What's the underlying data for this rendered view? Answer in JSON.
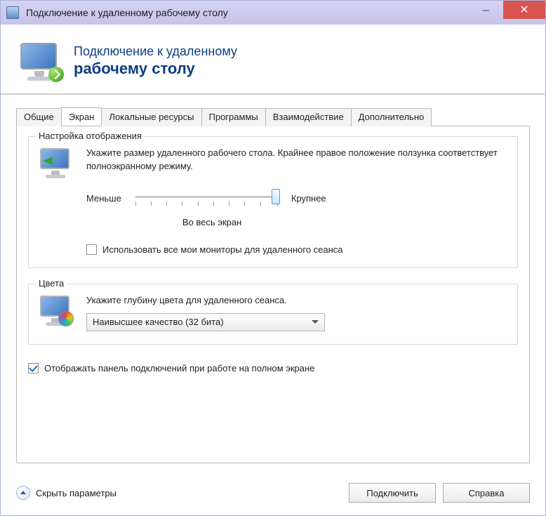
{
  "window": {
    "title": "Подключение к удаленному рабочему столу",
    "minimize_glyph": "─",
    "close_glyph": "✕"
  },
  "banner": {
    "line1": "Подключение к удаленному",
    "line2": "рабочему столу"
  },
  "tabs": [
    "Общие",
    "Экран",
    "Локальные ресурсы",
    "Программы",
    "Взаимодействие",
    "Дополнительно"
  ],
  "active_tab_index": 1,
  "display_group": {
    "legend": "Настройка отображения",
    "desc": "Укажите размер удаленного рабочего стола. Крайнее правое положение ползунка соответствует полноэкранному режиму.",
    "slider_min_label": "Меньше",
    "slider_max_label": "Крупнее",
    "slider_caption": "Во весь экран",
    "use_all_monitors": "Использовать все мои мониторы для удаленного сеанса",
    "use_all_monitors_checked": false
  },
  "color_group": {
    "legend": "Цвета",
    "desc": "Укажите глубину цвета для удаленного сеанса.",
    "selected": "Наивысшее качество (32 бита)"
  },
  "connection_bar": {
    "label": "Отображать панель подключений при работе на полном экране",
    "checked": true
  },
  "footer": {
    "hide_params": "Скрыть параметры",
    "connect": "Подключить",
    "help": "Справка"
  }
}
